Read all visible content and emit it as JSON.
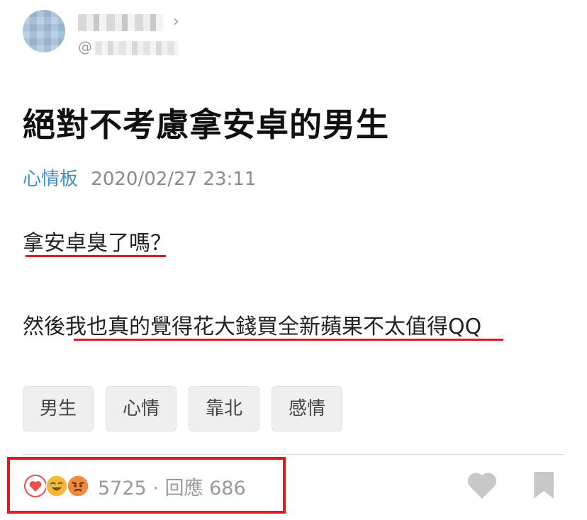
{
  "author": {
    "handle_prefix": "@",
    "chevron": "›"
  },
  "post": {
    "title": "絕對不考慮拿安卓的男生",
    "board": "心情板",
    "timestamp": "2020/02/27 23:11",
    "body_lines": [
      "拿安卓臭了嗎？",
      "然後我也真的覺得花大錢買全新蘋果不太值得QQ"
    ]
  },
  "tags": [
    "男生",
    "心情",
    "靠北",
    "感情"
  ],
  "footer": {
    "reactions": [
      "heart-reaction",
      "laugh-reaction",
      "angry-reaction"
    ],
    "reaction_count": "5725",
    "separator": "·",
    "replies_label": "回應",
    "replies_count": "686"
  },
  "colors": {
    "board_link": "#3d8fc6",
    "annotation_red": "#e0191f",
    "icon_gray": "#c8c8c8"
  }
}
